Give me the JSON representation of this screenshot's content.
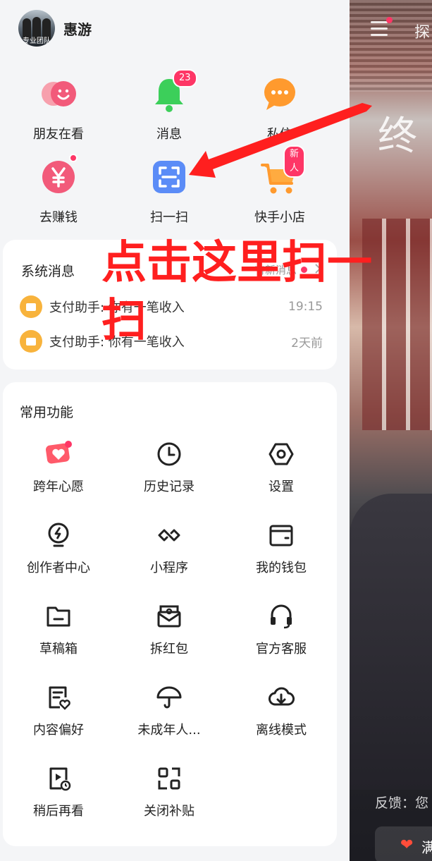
{
  "profile": {
    "name": "惠游",
    "avatar_caption": "专业团队"
  },
  "quick_actions": [
    {
      "label": "朋友在看",
      "icon": "friends-watching-icon"
    },
    {
      "label": "消息",
      "icon": "bell-icon",
      "badge": "23"
    },
    {
      "label": "私信",
      "icon": "chat-bubble-icon"
    },
    {
      "label": "去赚钱",
      "icon": "yuan-coin-icon"
    },
    {
      "label": "扫一扫",
      "icon": "scan-icon"
    },
    {
      "label": "快手小店",
      "icon": "shopping-cart-icon",
      "badge": "新人"
    }
  ],
  "system_messages": {
    "title": "系统消息",
    "more_label": "有新消息",
    "items": [
      {
        "text": "支付助手: 你有一笔收入",
        "time": "19:15"
      },
      {
        "text": "支付助手: 你有一笔收入",
        "time": "2天前"
      }
    ]
  },
  "common_functions": {
    "title": "常用功能",
    "items": [
      {
        "label": "跨年心愿",
        "icon": "wish-heart-icon"
      },
      {
        "label": "历史记录",
        "icon": "clock-icon"
      },
      {
        "label": "设置",
        "icon": "settings-hexagon-icon"
      },
      {
        "label": "创作者中心",
        "icon": "lightning-bulb-icon"
      },
      {
        "label": "小程序",
        "icon": "mini-program-icon"
      },
      {
        "label": "我的钱包",
        "icon": "wallet-icon"
      },
      {
        "label": "草稿箱",
        "icon": "folder-icon"
      },
      {
        "label": "拆红包",
        "icon": "red-envelope-icon"
      },
      {
        "label": "官方客服",
        "icon": "headset-icon"
      },
      {
        "label": "内容偏好",
        "icon": "content-preference-icon"
      },
      {
        "label": "未成年人...",
        "icon": "umbrella-icon"
      },
      {
        "label": "离线模式",
        "icon": "cloud-download-icon"
      },
      {
        "label": "稍后再看",
        "icon": "watch-later-icon"
      },
      {
        "label": "关闭补贴",
        "icon": "grid-apps-icon"
      }
    ]
  },
  "annotation": {
    "text": "点击这里扫一扫",
    "color": "#ff1f1f"
  },
  "background_video": {
    "tab_label": "探",
    "overlay_text": "终",
    "feedback_text": "反馈：您",
    "pill_text": "满"
  },
  "colors": {
    "accent_red": "#fe3666",
    "green": "#3ccf5a",
    "orange": "#ff9a2e",
    "blue": "#5b8cf7",
    "pink": "#f25a7a"
  }
}
